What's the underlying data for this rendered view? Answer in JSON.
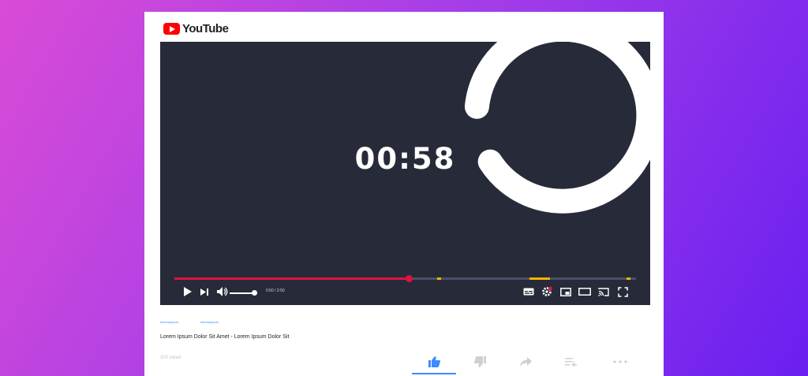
{
  "app": {
    "logo_text": "YouTube"
  },
  "player": {
    "timer": "00:58",
    "time_display": "0:50 / 2:50",
    "progress": 0.508,
    "volume": 1.0,
    "chapter_markers": [
      0.57,
      0.77,
      0.98
    ]
  },
  "controls": {
    "left": [
      "play-icon",
      "skip-next-icon",
      "volume-icon"
    ],
    "right": [
      "subtitles-icon",
      "settings-icon",
      "miniplayer-icon",
      "theater-mode-icon",
      "cast-icon",
      "fullscreen-icon"
    ]
  },
  "meta": {
    "tag_1": "#loremipsum",
    "tag_2": "#loremipsum",
    "title": "Lorem Ipsum Dolor Sit Amet - Lorem Ipsum Dolor Sit",
    "views": "300 views"
  },
  "actions": [
    "like-icon",
    "dislike-icon",
    "share-icon",
    "save-playlist-icon",
    "more-icon"
  ],
  "colors": {
    "brand_red": "#ff0000",
    "progress_red": "#e0123e",
    "marker_yellow": "#f4b400",
    "player_bg": "#272a38",
    "accent_blue": "#3d8bff"
  }
}
